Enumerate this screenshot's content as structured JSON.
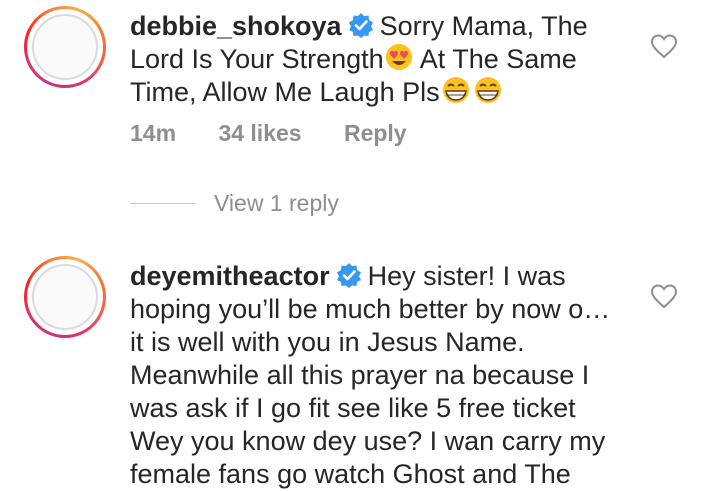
{
  "comments": [
    {
      "username": "debbie_shokoya",
      "text_parts": [
        "Sorry Mama, The Lord Is Your Strength",
        " At The Same Time, Allow Me Laugh Pls"
      ],
      "emojis": [
        "smiling-face-with-heart-eyes",
        "grinning-face",
        "grinning-face"
      ],
      "time": "14m",
      "likes": "34 likes",
      "reply_label": "Reply",
      "view_replies": "View 1 reply"
    },
    {
      "username": "deyemitheactor",
      "text": "Hey sister! I was hoping you’ll be much better by now o… it is well with you in Jesus Name. Meanwhile  all this prayer na because I was ask if I go fit see like 5 free ticket Wey you know dey use? I wan carry my female fans go watch Ghost and The"
    }
  ],
  "colors": {
    "text": "#262626",
    "muted": "#8e8e8e",
    "verified": "#3897f0"
  },
  "icons": {
    "verified": "verified-badge-icon",
    "like": "heart-outline-icon"
  }
}
